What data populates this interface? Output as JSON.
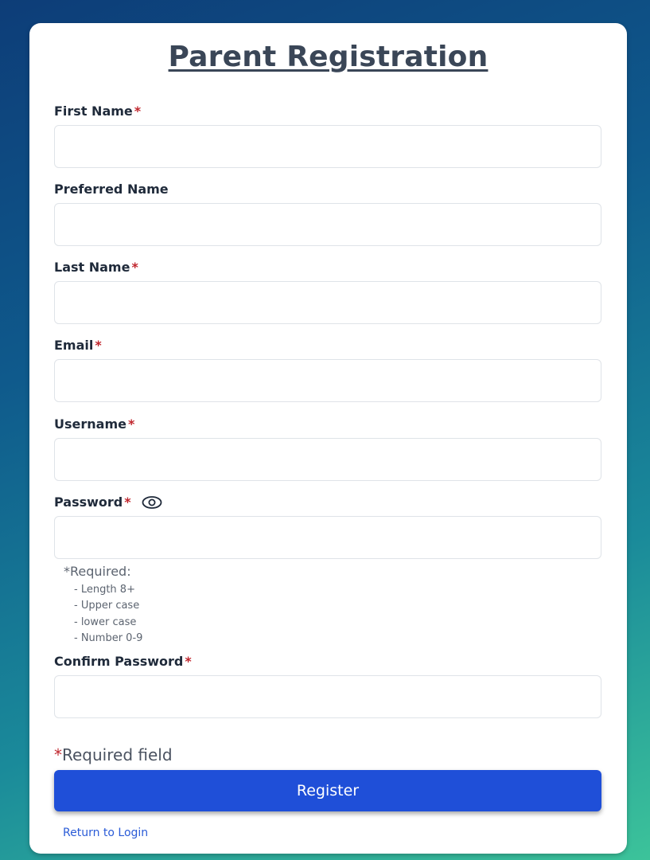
{
  "form": {
    "title": "Parent Registration",
    "required_marker": "*",
    "fields": {
      "first_name": {
        "label": "First Name",
        "value": "",
        "placeholder": ""
      },
      "preferred_name": {
        "label": "Preferred Name",
        "value": "",
        "placeholder": ""
      },
      "last_name": {
        "label": "Last Name",
        "value": "",
        "placeholder": ""
      },
      "email": {
        "label": "Email",
        "value": "",
        "placeholder": ""
      },
      "username": {
        "label": "Username",
        "value": "",
        "placeholder": ""
      },
      "password": {
        "label": "Password",
        "value": "",
        "placeholder": "",
        "toggle_icon": "eye-icon"
      },
      "confirm_password": {
        "label": "Confirm Password",
        "value": "",
        "placeholder": ""
      }
    },
    "password_requirements": {
      "title": "*Required:",
      "items": [
        "- Length 8+",
        "- Upper case",
        "- lower case",
        "- Number 0-9"
      ]
    },
    "required_note": "Required field",
    "register_label": "Register",
    "return_link": "Return to Login"
  },
  "colors": {
    "accent": "#1f4fd8",
    "required": "#c0262d",
    "link": "#2a5bd7"
  }
}
